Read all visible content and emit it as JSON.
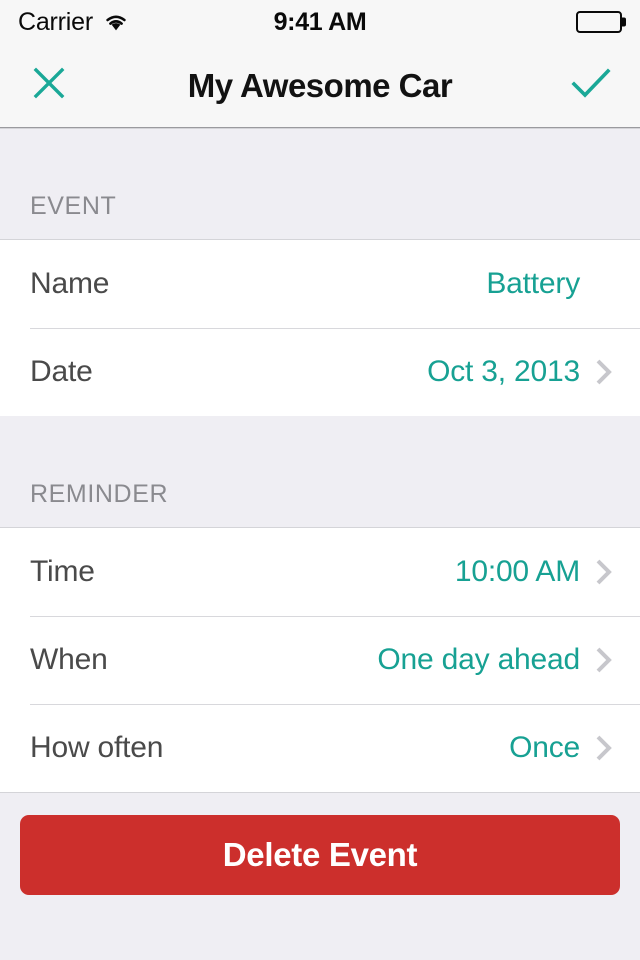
{
  "statusbar": {
    "carrier": "Carrier",
    "time": "9:41 AM",
    "wifi_icon": "wifi-icon",
    "battery_icon": "battery-full-icon"
  },
  "navbar": {
    "title": "My Awesome Car",
    "close_icon": "close-icon",
    "confirm_icon": "check-icon"
  },
  "colors": {
    "accent": "#17A193",
    "danger": "#CC2F2C",
    "group_background": "#EFEEF3",
    "row_background": "#FFFFFF",
    "section_label": "#8A8A8F",
    "chevron": "#C7C7CC"
  },
  "sections": [
    {
      "header": "EVENT",
      "rows": [
        {
          "label": "Name",
          "value": "Battery",
          "chevron": false
        },
        {
          "label": "Date",
          "value": "Oct 3, 2013",
          "chevron": true
        }
      ]
    },
    {
      "header": "REMINDER",
      "rows": [
        {
          "label": "Time",
          "value": "10:00 AM",
          "chevron": true
        },
        {
          "label": "When",
          "value": "One day ahead",
          "chevron": true
        },
        {
          "label": "How often",
          "value": "Once",
          "chevron": true
        }
      ]
    }
  ],
  "footer": {
    "delete_label": "Delete Event"
  }
}
